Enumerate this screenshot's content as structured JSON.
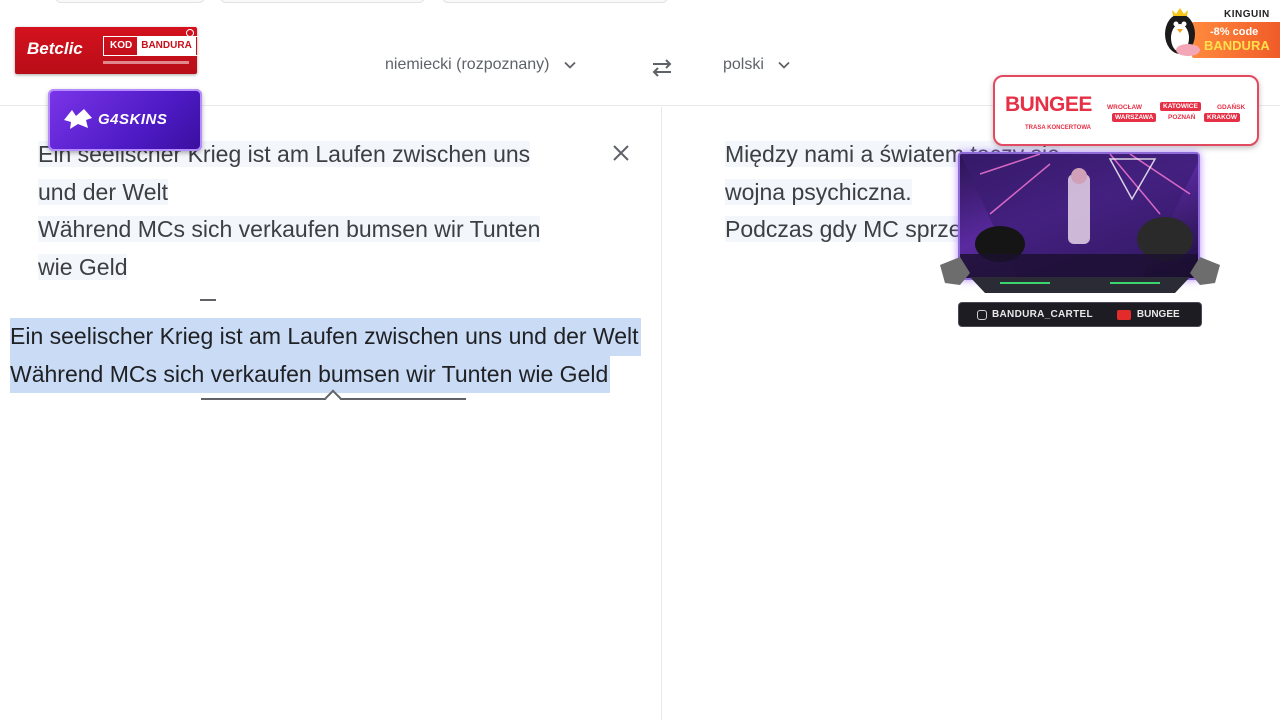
{
  "language_bar": {
    "source_language": "niemiecki (rozpoznany)",
    "target_language": "polski"
  },
  "source_panel": {
    "lines": [
      "Ein seelischer Krieg ist am Laufen zwischen uns",
      "und der Welt",
      "Während MCs sich verkaufen bumsen wir Tunten",
      "wie Geld"
    ]
  },
  "target_panel": {
    "lines": [
      "Między nami a światem toczy się",
      "wojna psychiczna.",
      "Podczas gdy MC sprzedają się"
    ]
  },
  "selection": {
    "lines": [
      "Ein seelischer Krieg ist am Laufen zwischen uns und der Welt",
      "Während MCs sich verkaufen bumsen wir Tunten wie Geld"
    ]
  },
  "overlays": {
    "betclic": {
      "brand": "Betclic",
      "kod_label": "KOD",
      "kod_value": "BANDURA"
    },
    "g4skins": {
      "name": "G4SKINS"
    },
    "kinguin": {
      "label": "KINGUIN",
      "discount": "-8% code",
      "code": "BANDURA"
    },
    "bungee": {
      "title": "BUNGEE",
      "subtitle": "TRASA KONCERTOWA",
      "cities": [
        "WROCŁAW",
        "KATOWICE",
        "GDAŃSK",
        "WARSZAWA",
        "POZNAŃ",
        "KRAKÓW"
      ]
    },
    "stream_bar": {
      "instagram": "BANDURA_CARTEL",
      "youtube": "BUNGEE"
    }
  },
  "colors": {
    "selection_bg": "#c9dbf5",
    "accent_red": "#e63046",
    "g4_purple": "#5a22d4"
  }
}
